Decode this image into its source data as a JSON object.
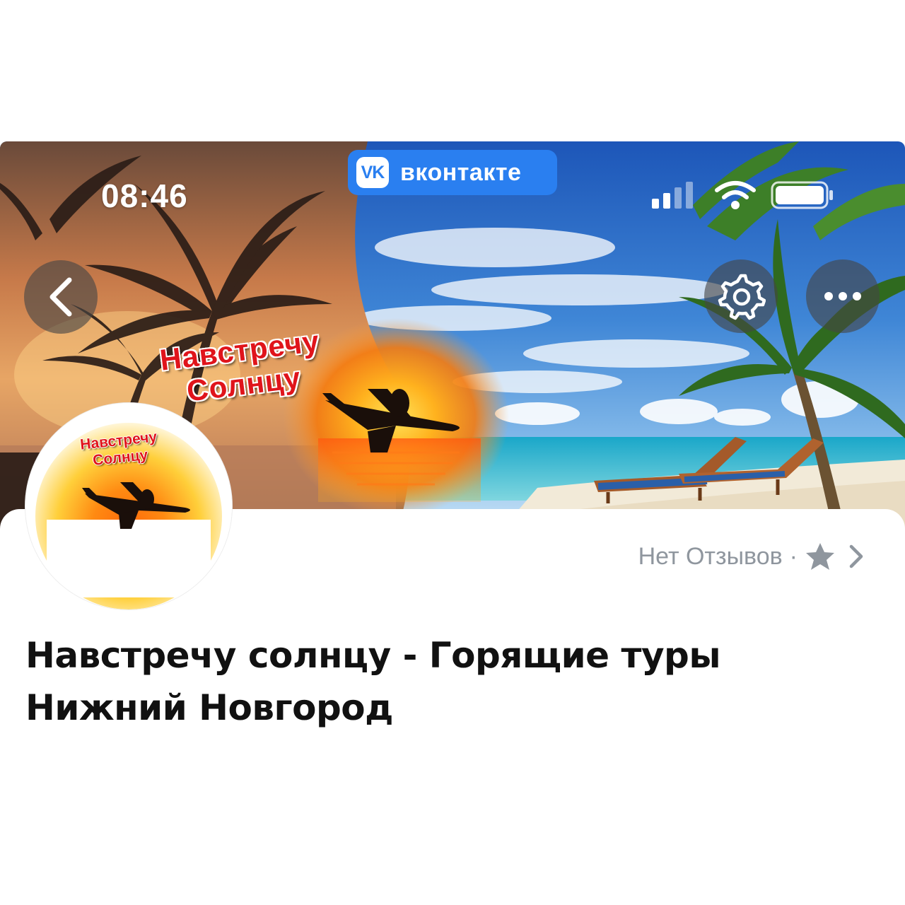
{
  "status_bar": {
    "time": "08:46",
    "app_badge": "вконтакте",
    "app_badge_logo": "vk"
  },
  "cover": {
    "banner_line1": "Навстречу",
    "banner_line2": "Солнцу"
  },
  "avatar": {
    "line1": "Навстречу",
    "line2": "Солнцу"
  },
  "reviews": {
    "label": "Нет Отзывов",
    "separator": "·"
  },
  "group": {
    "title_line1": "Навстречу солнцу - Горящие туры",
    "title_line2": "Нижний Новгород"
  },
  "icons": {
    "back": "chevron-left-icon",
    "settings": "gear-icon",
    "more": "more-horizontal-icon",
    "star": "star-icon",
    "chevron": "chevron-right-icon"
  },
  "colors": {
    "vk_blue": "#2a7ff0",
    "banner_red": "#e0141b",
    "muted_text": "#8f969e"
  }
}
